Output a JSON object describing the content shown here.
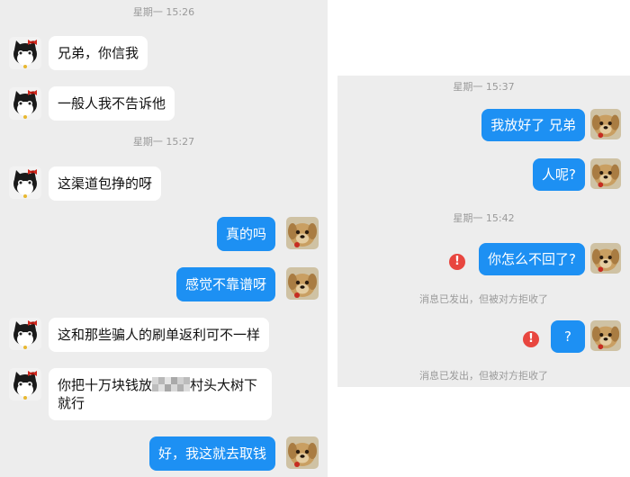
{
  "left": {
    "stamps": [
      "星期一 15:26",
      "星期一 15:27"
    ],
    "messages": {
      "m1": "兄弟，你信我",
      "m2": "一般人我不告诉他",
      "m3": "这渠道包挣的呀",
      "m4": "真的吗",
      "m5": "感觉不靠谱呀",
      "m6": "这和那些骗人的刷单返利可不一样",
      "m7_part1": "你把十万块钱放",
      "m7_part2": "村头大树下",
      "m7_part3": "就行",
      "m8": "好，我这就去取钱"
    }
  },
  "right": {
    "stamps": [
      "星期一 15:37",
      "星期一 15:42"
    ],
    "messages": {
      "r1": "我放好了 兄弟",
      "r2": "人呢?",
      "r3": "你怎么不回了?",
      "r4": "?"
    },
    "error_glyph": "!",
    "notice": "消息已发出，但被对方拒收了",
    "colors": {
      "sent_bubble": "#1d90f3",
      "error": "#e8463f"
    }
  },
  "icons": {
    "contact_avatar": "cat-avatar-icon",
    "self_avatar": "dog-avatar-icon"
  }
}
